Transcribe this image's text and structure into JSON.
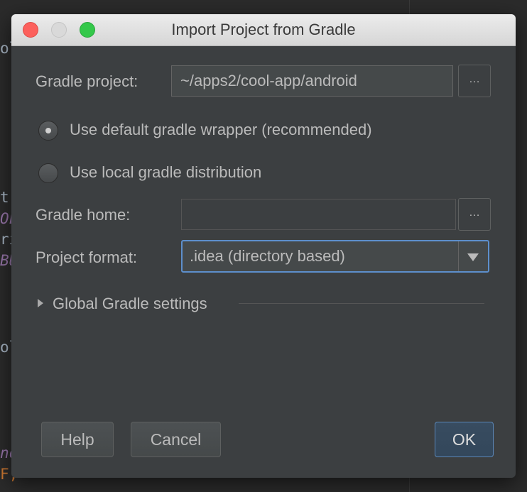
{
  "background_code": [
    "ol",
    "t",
    "OL",
    "ri",
    "BU",
    "ol",
    "nd",
    "F,"
  ],
  "dialog": {
    "title": "Import Project from Gradle",
    "gradle_project": {
      "label": "Gradle project:",
      "value": "~/apps2/cool-app/android",
      "browse_label": "…"
    },
    "radio_default": {
      "label": "Use default gradle wrapper (recommended)",
      "selected": true
    },
    "radio_local": {
      "label": "Use local gradle distribution",
      "selected": false
    },
    "gradle_home": {
      "label": "Gradle home:",
      "value": "",
      "browse_label": "…"
    },
    "project_format": {
      "label": "Project format:",
      "value": ".idea (directory based)"
    },
    "global_settings": {
      "label": "Global Gradle settings",
      "expanded": false
    },
    "buttons": {
      "help": "Help",
      "cancel": "Cancel",
      "ok": "OK"
    }
  },
  "colors": {
    "dialog_bg": "#3c3f41",
    "accent_focus": "#5d8fcc",
    "primary_button": "#33475b",
    "text": "#bbbbbb"
  }
}
